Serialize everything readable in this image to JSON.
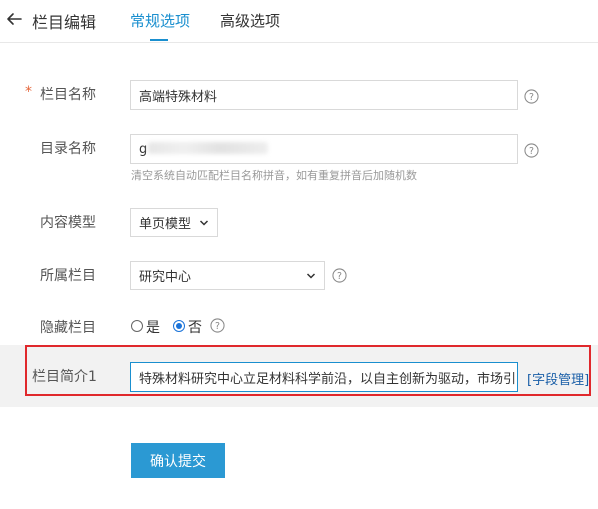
{
  "header": {
    "title": "栏目编辑",
    "tabs": [
      {
        "label": "常规选项",
        "active": true
      },
      {
        "label": "高级选项",
        "active": false
      }
    ]
  },
  "form": {
    "column_name": {
      "required_mark": "*",
      "label": "栏目名称",
      "value": "高端特殊材料"
    },
    "dir_name": {
      "label": "目录名称",
      "value": "g",
      "hint": "清空系统自动匹配栏目名称拼音，如有重复拼音后加随机数"
    },
    "content_model": {
      "label": "内容模型",
      "selected": "单页模型"
    },
    "parent_column": {
      "label": "所属栏目",
      "selected": "研究中心"
    },
    "hidden_column": {
      "label": "隐藏栏目",
      "options": [
        "是",
        "否"
      ],
      "selected": "否"
    },
    "column_intro": {
      "label": "栏目简介1",
      "value": "特殊材料研究中心立足材料科学前沿，以自主创新为驱动，市场引",
      "link": "[字段管理]"
    }
  },
  "submit_label": "确认提交",
  "colors": {
    "accent": "#1a8fcf",
    "button": "#2b99d3",
    "required": "#e5663a",
    "highlight_border": "#e0282c"
  },
  "icons": [
    "back-arrow-icon",
    "help-icon",
    "chevron-down-icon"
  ]
}
